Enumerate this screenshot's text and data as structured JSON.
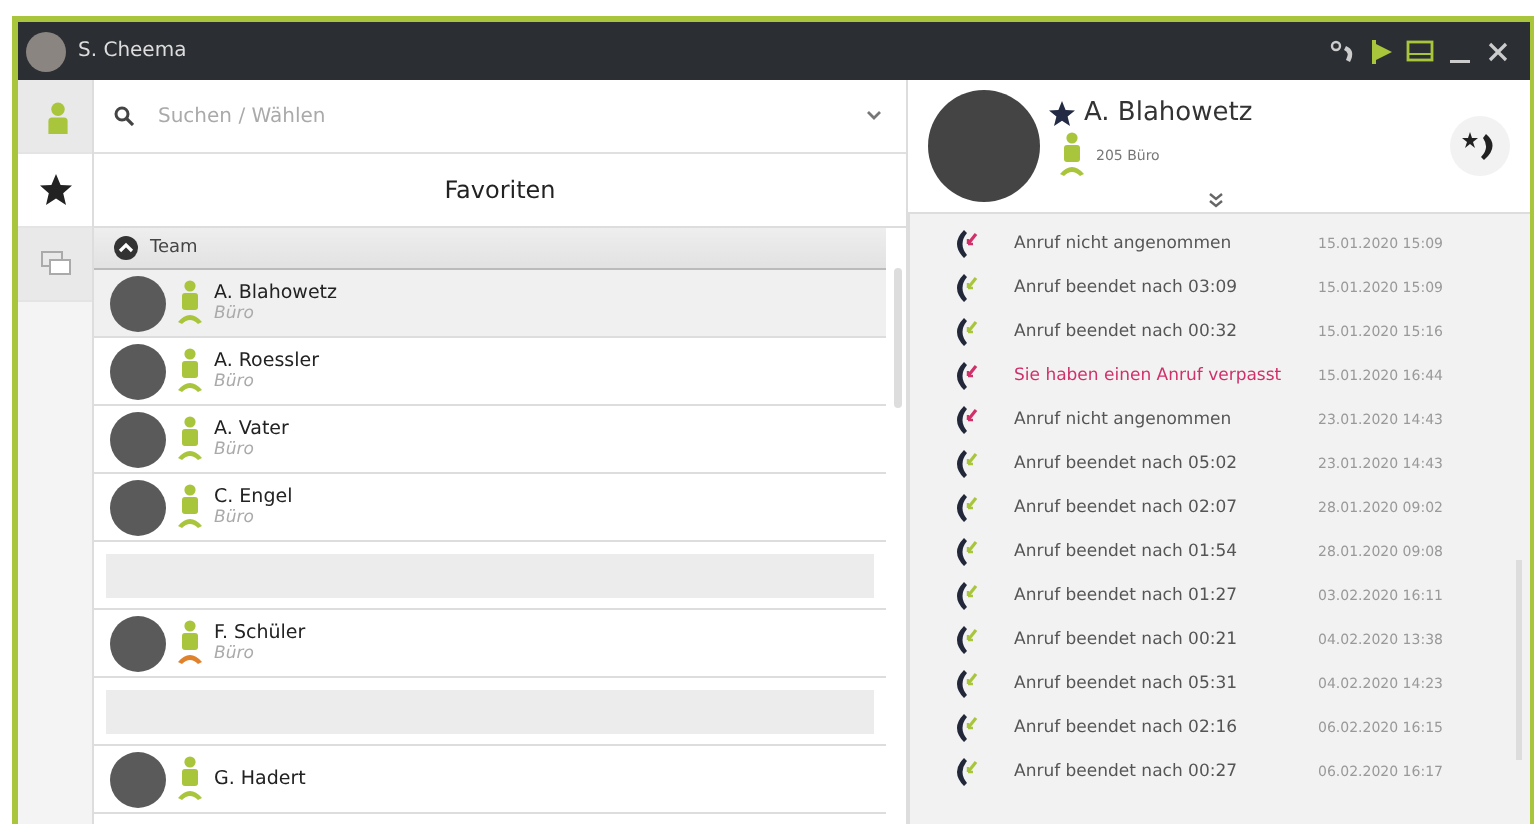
{
  "window": {
    "user": "S. Cheema"
  },
  "nav": [
    {
      "selected": false
    },
    {
      "selected": true
    },
    {
      "selected": false
    }
  ],
  "search": {
    "placeholder": "Suchen / Wählen"
  },
  "favorites": {
    "title": "Favoriten",
    "group": {
      "label": "Team",
      "expanded": true
    },
    "contacts": [
      {
        "kind": "contact",
        "name": "A. Blahowetz",
        "location": "Büro",
        "selected": true,
        "color": "#a8c53c"
      },
      {
        "kind": "contact",
        "name": "A. Roessler",
        "location": "Büro",
        "selected": false,
        "color": "#a8c53c"
      },
      {
        "kind": "contact",
        "name": "A. Vater",
        "location": "Büro",
        "selected": false,
        "color": "#a8c53c"
      },
      {
        "kind": "contact",
        "name": "C. Engel",
        "location": "Büro",
        "selected": false,
        "color": "#a8c53c"
      },
      {
        "kind": "empty",
        "selected": false
      },
      {
        "kind": "contact",
        "name": "F. Schüler",
        "location": "Büro",
        "selected": false,
        "color": "#e0822c"
      },
      {
        "kind": "empty",
        "selected": false
      },
      {
        "kind": "contact",
        "name": "G. Hadert",
        "selected": false,
        "color": "#a8c53c"
      }
    ]
  },
  "detail": {
    "name": "A. Blahowetz",
    "extension": "205 Büro",
    "favorite": true,
    "calls": [
      {
        "kind": "unanswered",
        "text": "Anruf nicht angenommen",
        "time": "15.01.2020 15:09"
      },
      {
        "kind": "ended",
        "text": "Anruf beendet nach 03:09",
        "time": "15.01.2020 15:09"
      },
      {
        "kind": "ended",
        "text": "Anruf beendet nach 00:32",
        "time": "15.01.2020 15:16"
      },
      {
        "kind": "missed",
        "text": "Sie haben einen Anruf verpasst",
        "time": "15.01.2020 16:44"
      },
      {
        "kind": "unanswered",
        "text": "Anruf nicht angenommen",
        "time": "23.01.2020 14:43"
      },
      {
        "kind": "ended",
        "text": "Anruf beendet nach 05:02",
        "time": "23.01.2020 14:43"
      },
      {
        "kind": "ended",
        "text": "Anruf beendet nach 02:07",
        "time": "28.01.2020 09:02"
      },
      {
        "kind": "ended",
        "text": "Anruf beendet nach 01:54",
        "time": "28.01.2020 09:08"
      },
      {
        "kind": "ended",
        "text": "Anruf beendet nach 01:27",
        "time": "03.02.2020 16:11"
      },
      {
        "kind": "ended",
        "text": "Anruf beendet nach 00:21",
        "time": "04.02.2020 13:38"
      },
      {
        "kind": "ended",
        "text": "Anruf beendet nach 05:31",
        "time": "04.02.2020 14:23"
      },
      {
        "kind": "ended",
        "text": "Anruf beendet nach 02:16",
        "time": "06.02.2020 16:15"
      },
      {
        "kind": "ended",
        "text": "Anruf beendet nach 00:27",
        "time": "06.02.2020 16:17"
      }
    ]
  }
}
